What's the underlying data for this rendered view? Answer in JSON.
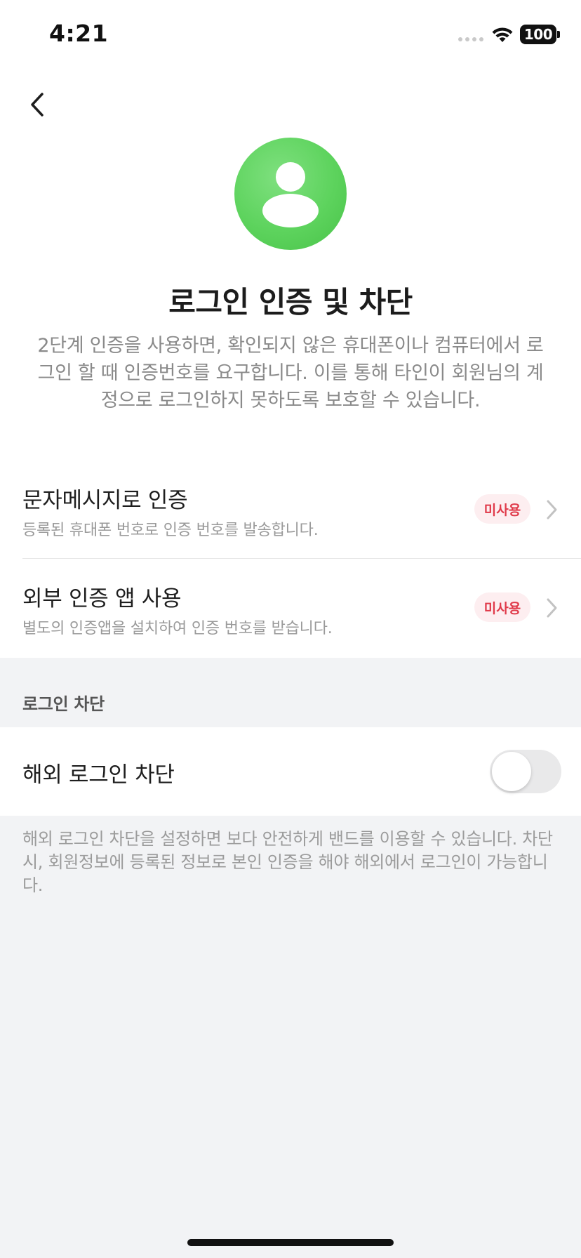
{
  "status_bar": {
    "time": "4:21",
    "battery": "100"
  },
  "header": {
    "back_icon": "chevron-left-icon",
    "avatar_icon": "person-icon",
    "avatar_color": "#5dd35d",
    "title": "로그인 인증 및 차단",
    "description": "2단계 인증을 사용하면, 확인되지 않은 휴대폰이나 컴퓨터에서 로그인 할 때 인증번호를 요구합니다. 이를 통해 타인이 회원님의 계정으로 로그인하지 못하도록 보호할 수 있습니다."
  },
  "auth_methods": [
    {
      "title": "문자메시지로 인증",
      "subtitle": "등록된 휴대폰 번호로 인증 번호를 발송합니다.",
      "status": "미사용"
    },
    {
      "title": "외부 인증 앱 사용",
      "subtitle": "별도의 인증앱을 설치하여 인증 번호를 받습니다.",
      "status": "미사용"
    }
  ],
  "login_block": {
    "section_title": "로그인 차단",
    "toggle_label": "해외 로그인 차단",
    "toggle_on": false,
    "footnote": "해외 로그인 차단을 설정하면 보다 안전하게 밴드를 이용할 수 있습니다. 차단시, 회원정보에 등록된 정보로 본인 인증을 해야 해외에서 로그인이 가능합니다."
  },
  "colors": {
    "badge_text": "#e03a4a",
    "badge_bg": "#fdeef0",
    "background": "#f2f3f5"
  }
}
